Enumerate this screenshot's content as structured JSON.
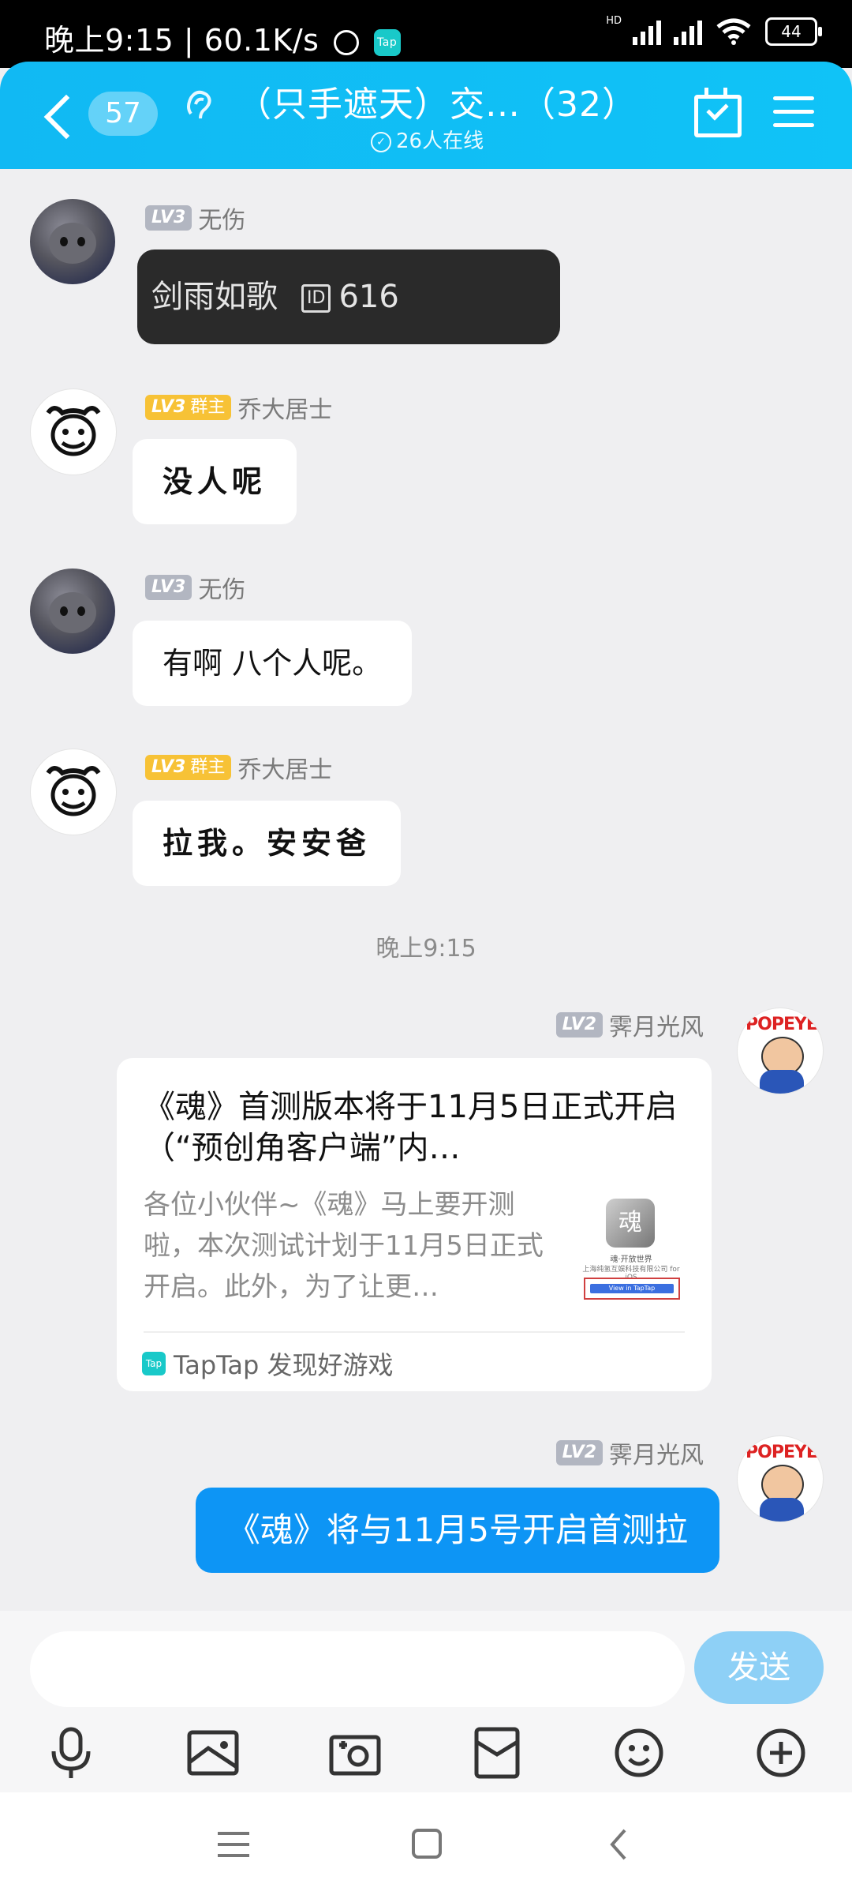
{
  "status_bar": {
    "time": "晚上9:15 | 60.1K/s",
    "tap_badge": "Tap",
    "hd": "HD",
    "battery": "44"
  },
  "header": {
    "unread_count": "57",
    "title": "（只手遮天）交…（32）",
    "online": "26人在线"
  },
  "messages": [
    {
      "name": "无伤",
      "level": "LV3",
      "role": "",
      "text": "剑雨如歌",
      "id_label": "ID",
      "id_value": "616"
    },
    {
      "name": "乔大居士",
      "level": "LV3",
      "role": "群主",
      "text": "没人呢"
    },
    {
      "name": "无伤",
      "level": "LV3",
      "role": "",
      "text": "有啊 八个人呢。"
    },
    {
      "name": "乔大居士",
      "level": "LV3",
      "role": "群主",
      "text": "拉我。安安爸"
    },
    {
      "name": "霁月光风",
      "level": "LV2",
      "role": "",
      "text": ""
    },
    {
      "name": "霁月光风",
      "level": "LV2",
      "role": "",
      "text": "《魂》将与11月5号开启首测拉"
    }
  ],
  "timestamp": "晚上9:15",
  "share_card": {
    "title": "《魂》首测版本将于11月5日正式开启（“预创角客户端”内…",
    "description": "各位小伙伴~《魂》马上要开测啦，本次测试计划于11月5日正式开启。此外，为了让更…",
    "thumb_logo": "魂",
    "thumb_line1": "魂·开放世界",
    "thumb_line2": "上海纯氢互娱科技有限公司 for iOS",
    "thumb_button": "View in TapTap",
    "source_icon": "Tap",
    "source": "TapTap 发现好游戏"
  },
  "input": {
    "placeholder": "",
    "send_label": "发送"
  },
  "avatars": {
    "popeye_text": "POPEYE"
  },
  "colors": {
    "header": "#11b9f3",
    "send_button": "#8ed0f6",
    "outgoing_bubble": "#0d95f5",
    "owner_badge": "#f7c236"
  }
}
